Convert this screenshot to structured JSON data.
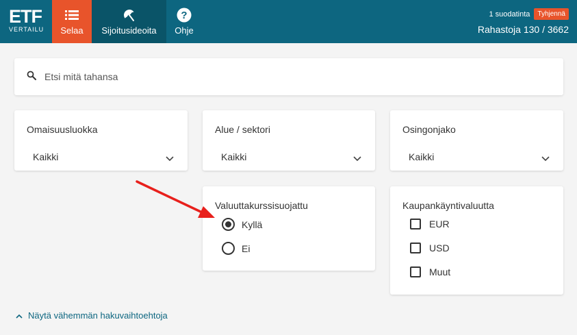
{
  "header": {
    "logo_main": "ETF",
    "logo_sub": "VERTAILU",
    "nav": [
      {
        "label": "Selaa",
        "icon": "list-icon",
        "active": true
      },
      {
        "label": "Sijoitusideoita",
        "icon": "umbrella-icon"
      },
      {
        "label": "Ohje",
        "icon": "help-icon"
      }
    ],
    "filters_active": "1 suodatinta",
    "clear_label": "Tyhjennä",
    "fund_count": "Rahastoja 130 / 3662"
  },
  "search": {
    "placeholder": "Etsi mitä tahansa",
    "value": ""
  },
  "filters": {
    "asset_class": {
      "title": "Omaisuusluokka",
      "value": "Kaikki"
    },
    "region": {
      "title": "Alue / sektori",
      "value": "Kaikki"
    },
    "dividend": {
      "title": "Osingonjako",
      "value": "Kaikki"
    },
    "hedged": {
      "title": "Valuuttakurssisuojattu",
      "options": [
        {
          "label": "Kyllä",
          "selected": true
        },
        {
          "label": "Ei",
          "selected": false
        }
      ]
    },
    "currency": {
      "title": "Kaupankäyntivaluutta",
      "options": [
        {
          "label": "EUR",
          "checked": false
        },
        {
          "label": "USD",
          "checked": false
        },
        {
          "label": "Muut",
          "checked": false
        }
      ]
    }
  },
  "show_less_label": "Näytä vähemmän hakuvaihtoehtoja",
  "colors": {
    "header_bg": "#0d6680",
    "accent": "#e8542b",
    "annotation_arrow": "#e8201c"
  }
}
